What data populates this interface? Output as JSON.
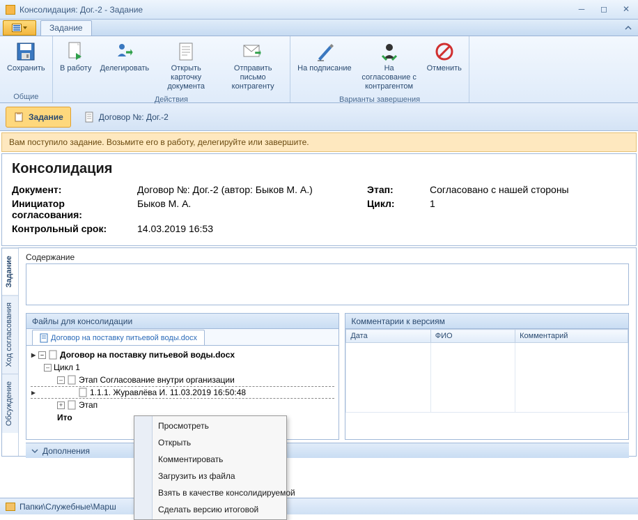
{
  "title": "Консолидация: Дог.-2 - Задание",
  "ribbon": {
    "tab": "Задание",
    "groups": {
      "common": "Общие",
      "actions": "Действия",
      "variants": "Варианты завершения"
    },
    "buttons": {
      "save": "Сохранить",
      "towork": "В работу",
      "delegate": "Делегировать",
      "opencard": "Открыть карточку документа",
      "sendletter": "Отправить письмо контрагенту",
      "tosign": "На подписание",
      "toagree": "На согласование с контрагентом",
      "cancel": "Отменить"
    }
  },
  "subtabs": {
    "task": "Задание",
    "doc": "Договор №: Дог.-2"
  },
  "notice": "Вам поступило задание. Возьмите его в работу, делегируйте или завершите.",
  "info": {
    "heading": "Консолидация",
    "labels": {
      "document": "Документ:",
      "initiator": "Инициатор согласования:",
      "deadline": "Контрольный срок:",
      "stage": "Этап:",
      "cycle": "Цикл:"
    },
    "values": {
      "document": "Договор №: Дог.-2 (автор: Быков М. А.)",
      "initiator": "Быков М. А.",
      "deadline": "14.03.2019 16:53",
      "stage": "Согласовано с нашей стороны",
      "cycle": "1"
    }
  },
  "vtabs": {
    "task": "Задание",
    "progress": "Ход согласования",
    "discussion": "Обсуждение"
  },
  "content": {
    "content_label": "Содержание"
  },
  "left_panel": {
    "header": "Файлы для консолидации",
    "filetab": "Договор на поставку питьевой воды.docx",
    "tree": {
      "root": "Договор на поставку питьевой воды.docx",
      "cycle": "Цикл 1",
      "stage1": "Этап Согласование внутри организации",
      "version": "1.1.1.  Журавлёва И.   11.03.2019 16:50:48",
      "stage2": "Этап",
      "summary": "Ито"
    }
  },
  "right_panel": {
    "header": "Комментарии к версиям",
    "cols": {
      "date": "Дата",
      "fio": "ФИО",
      "comment": "Комментарий"
    }
  },
  "additions": "Дополнения",
  "statusbar": "Папки\\Служебные\\Марш",
  "context_menu": {
    "view": "Просмотреть",
    "open": "Открыть",
    "comment": "Комментировать",
    "load": "Загрузить из файла",
    "take": "Взять в качестве консолидируемой",
    "makefinal": "Сделать версию итоговой"
  }
}
